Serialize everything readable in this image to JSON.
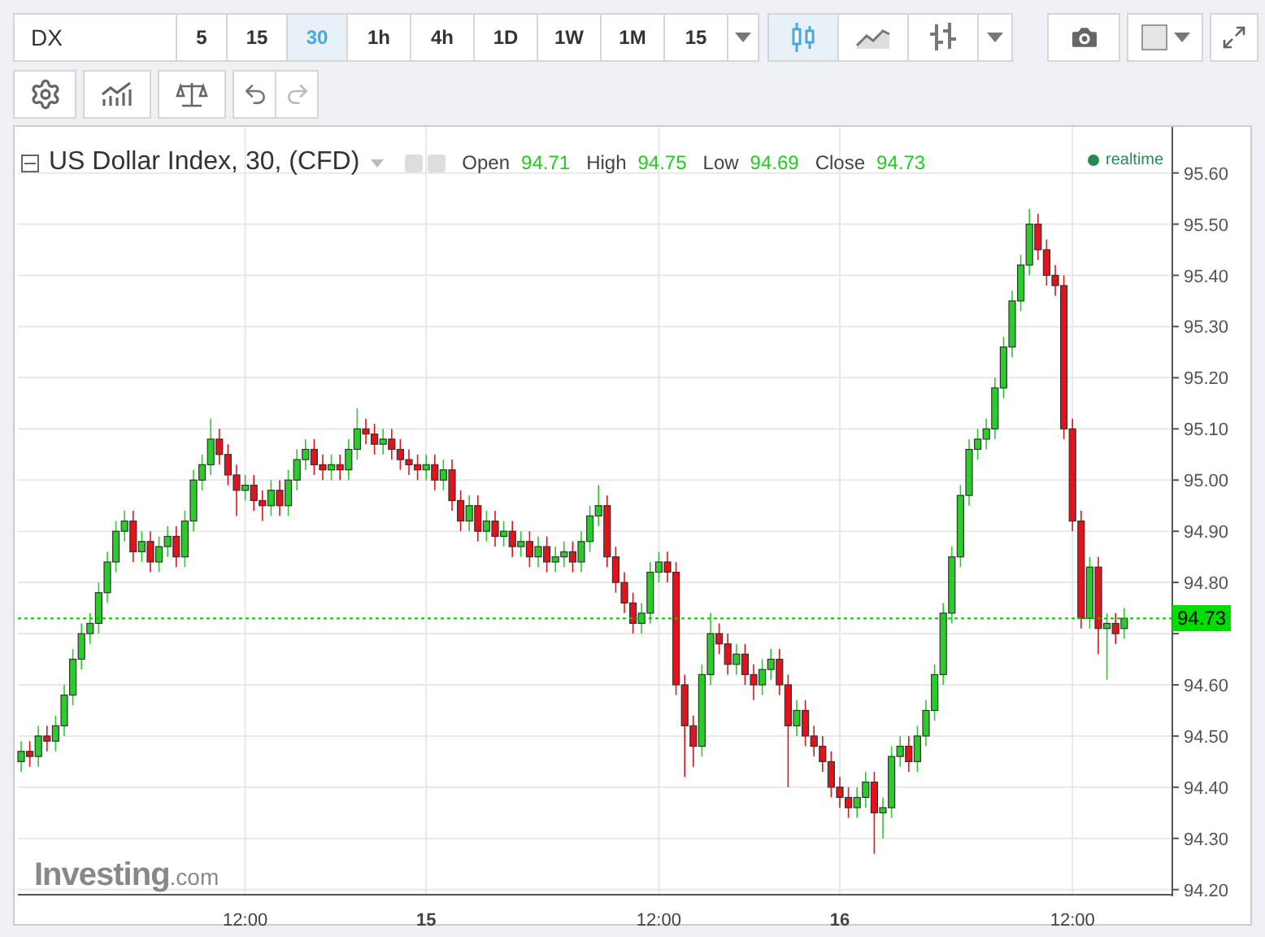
{
  "symbol": {
    "value": "DX"
  },
  "intervals": [
    {
      "label": "5",
      "selected": false
    },
    {
      "label": "15",
      "selected": false
    },
    {
      "label": "30",
      "selected": true
    },
    {
      "label": "1h",
      "selected": false
    },
    {
      "label": "4h",
      "selected": false
    },
    {
      "label": "1D",
      "selected": false
    },
    {
      "label": "1W",
      "selected": false
    },
    {
      "label": "1M",
      "selected": false
    },
    {
      "label": "15",
      "selected": false
    }
  ],
  "chart_types": [
    {
      "kind": "candles",
      "selected": true
    },
    {
      "kind": "line",
      "selected": false
    },
    {
      "kind": "bars",
      "selected": false
    }
  ],
  "legend": {
    "title": "US Dollar Index, 30, (CFD)",
    "fields": [
      {
        "label": "Open",
        "value": "94.71"
      },
      {
        "label": "High",
        "value": "94.75"
      },
      {
        "label": "Low",
        "value": "94.69"
      },
      {
        "label": "Close",
        "value": "94.73"
      }
    ],
    "status": "realtime"
  },
  "chart_data": {
    "type": "candlestick",
    "categories": [
      null,
      null,
      null,
      null,
      null,
      null,
      null,
      null,
      null,
      null,
      null,
      null,
      null,
      null,
      null,
      null,
      null,
      null,
      null,
      null,
      null,
      null,
      null,
      null,
      null,
      null,
      "12:00",
      null,
      null,
      null,
      null,
      null,
      null,
      null,
      null,
      null,
      null,
      null,
      null,
      null,
      null,
      null,
      null,
      null,
      null,
      null,
      null,
      "15",
      null,
      null,
      null,
      null,
      null,
      null,
      null,
      null,
      null,
      null,
      null,
      null,
      null,
      null,
      null,
      null,
      null,
      null,
      null,
      null,
      null,
      null,
      null,
      null,
      null,
      null,
      "12:00",
      null,
      null,
      null,
      null,
      null,
      null,
      null,
      null,
      null,
      null,
      null,
      null,
      null,
      null,
      null,
      null,
      null,
      null,
      null,
      null,
      "16",
      null,
      null,
      null,
      null,
      null,
      null,
      null,
      null,
      null,
      null,
      null,
      null,
      null,
      null,
      null,
      null,
      null,
      null,
      null,
      null,
      null,
      null,
      null,
      null,
      null,
      null,
      "12:00",
      null,
      null,
      null,
      null,
      null,
      null
    ],
    "ohlc": [
      [
        94.45,
        94.49,
        94.43,
        94.47
      ],
      [
        94.47,
        94.49,
        94.44,
        94.46
      ],
      [
        94.46,
        94.52,
        94.44,
        94.5
      ],
      [
        94.5,
        94.52,
        94.47,
        94.49
      ],
      [
        94.49,
        94.54,
        94.47,
        94.52
      ],
      [
        94.52,
        94.6,
        94.5,
        94.58
      ],
      [
        94.58,
        94.67,
        94.56,
        94.65
      ],
      [
        94.65,
        94.72,
        94.63,
        94.7
      ],
      [
        94.7,
        94.74,
        94.68,
        94.72
      ],
      [
        94.72,
        94.8,
        94.7,
        94.78
      ],
      [
        94.78,
        94.86,
        94.76,
        94.84
      ],
      [
        94.84,
        94.92,
        94.82,
        94.9
      ],
      [
        94.9,
        94.94,
        94.88,
        94.92
      ],
      [
        94.92,
        94.94,
        94.84,
        94.86
      ],
      [
        94.86,
        94.9,
        94.84,
        94.88
      ],
      [
        94.88,
        94.9,
        94.82,
        94.84
      ],
      [
        94.84,
        94.89,
        94.82,
        94.87
      ],
      [
        94.87,
        94.91,
        94.85,
        94.89
      ],
      [
        94.89,
        94.91,
        94.83,
        94.85
      ],
      [
        94.85,
        94.94,
        94.83,
        94.92
      ],
      [
        94.92,
        95.02,
        94.9,
        95.0
      ],
      [
        95.0,
        95.05,
        94.98,
        95.03
      ],
      [
        95.03,
        95.12,
        95.01,
        95.08
      ],
      [
        95.08,
        95.1,
        95.03,
        95.05
      ],
      [
        95.05,
        95.07,
        94.99,
        95.01
      ],
      [
        95.01,
        95.03,
        94.93,
        94.98
      ],
      [
        94.98,
        95.01,
        94.96,
        94.99
      ],
      [
        94.99,
        95.01,
        94.94,
        94.96
      ],
      [
        94.96,
        94.98,
        94.92,
        94.95
      ],
      [
        94.95,
        95.0,
        94.93,
        94.98
      ],
      [
        94.98,
        95.0,
        94.93,
        94.95
      ],
      [
        94.95,
        95.02,
        94.93,
        95.0
      ],
      [
        95.0,
        95.06,
        94.98,
        95.04
      ],
      [
        95.04,
        95.08,
        95.02,
        95.06
      ],
      [
        95.06,
        95.08,
        95.01,
        95.03
      ],
      [
        95.03,
        95.05,
        95.0,
        95.02
      ],
      [
        95.02,
        95.05,
        95.0,
        95.03
      ],
      [
        95.03,
        95.05,
        95.0,
        95.02
      ],
      [
        95.02,
        95.08,
        95.0,
        95.06
      ],
      [
        95.06,
        95.14,
        95.04,
        95.1
      ],
      [
        95.1,
        95.12,
        95.07,
        95.09
      ],
      [
        95.09,
        95.11,
        95.05,
        95.07
      ],
      [
        95.07,
        95.1,
        95.05,
        95.08
      ],
      [
        95.08,
        95.1,
        95.04,
        95.06
      ],
      [
        95.06,
        95.08,
        95.02,
        95.04
      ],
      [
        95.04,
        95.06,
        95.01,
        95.03
      ],
      [
        95.03,
        95.05,
        95.0,
        95.02
      ],
      [
        95.02,
        95.05,
        95.0,
        95.03
      ],
      [
        95.03,
        95.05,
        94.98,
        95.0
      ],
      [
        95.0,
        95.04,
        94.98,
        95.02
      ],
      [
        95.02,
        95.04,
        94.94,
        94.96
      ],
      [
        94.96,
        94.98,
        94.9,
        94.92
      ],
      [
        94.92,
        94.97,
        94.9,
        94.95
      ],
      [
        94.95,
        94.97,
        94.88,
        94.9
      ],
      [
        94.9,
        94.94,
        94.88,
        94.92
      ],
      [
        94.92,
        94.94,
        94.87,
        94.89
      ],
      [
        94.89,
        94.92,
        94.87,
        94.9
      ],
      [
        94.9,
        94.92,
        94.85,
        94.87
      ],
      [
        94.87,
        94.9,
        94.85,
        94.88
      ],
      [
        94.88,
        94.9,
        94.83,
        94.85
      ],
      [
        94.85,
        94.89,
        94.83,
        94.87
      ],
      [
        94.87,
        94.89,
        94.82,
        94.84
      ],
      [
        94.84,
        94.87,
        94.82,
        94.85
      ],
      [
        94.85,
        94.88,
        94.83,
        94.86
      ],
      [
        94.86,
        94.88,
        94.82,
        94.84
      ],
      [
        94.84,
        94.9,
        94.82,
        94.88
      ],
      [
        94.88,
        94.95,
        94.86,
        94.93
      ],
      [
        94.93,
        94.99,
        94.91,
        94.95
      ],
      [
        94.95,
        94.97,
        94.83,
        94.85
      ],
      [
        94.85,
        94.87,
        94.78,
        94.8
      ],
      [
        94.8,
        94.82,
        94.74,
        94.76
      ],
      [
        94.76,
        94.78,
        94.7,
        94.72
      ],
      [
        94.72,
        94.76,
        94.7,
        94.74
      ],
      [
        94.74,
        94.84,
        94.72,
        94.82
      ],
      [
        94.82,
        94.86,
        94.8,
        94.84
      ],
      [
        94.84,
        94.86,
        94.8,
        94.82
      ],
      [
        94.82,
        94.84,
        94.58,
        94.6
      ],
      [
        94.6,
        94.62,
        94.42,
        94.52
      ],
      [
        94.52,
        94.54,
        94.44,
        94.48
      ],
      [
        94.48,
        94.64,
        94.46,
        94.62
      ],
      [
        94.62,
        94.74,
        94.6,
        94.7
      ],
      [
        94.7,
        94.72,
        94.66,
        94.68
      ],
      [
        94.68,
        94.7,
        94.62,
        94.64
      ],
      [
        94.64,
        94.68,
        94.62,
        94.66
      ],
      [
        94.66,
        94.68,
        94.6,
        94.62
      ],
      [
        94.62,
        94.64,
        94.57,
        94.6
      ],
      [
        94.6,
        94.65,
        94.58,
        94.63
      ],
      [
        94.63,
        94.67,
        94.61,
        94.65
      ],
      [
        94.65,
        94.67,
        94.58,
        94.6
      ],
      [
        94.6,
        94.62,
        94.4,
        94.52
      ],
      [
        94.52,
        94.57,
        94.5,
        94.55
      ],
      [
        94.55,
        94.57,
        94.48,
        94.5
      ],
      [
        94.5,
        94.52,
        94.46,
        94.48
      ],
      [
        94.48,
        94.5,
        94.43,
        94.45
      ],
      [
        94.45,
        94.47,
        94.38,
        94.4
      ],
      [
        94.4,
        94.42,
        94.36,
        94.38
      ],
      [
        94.38,
        94.4,
        94.34,
        94.36
      ],
      [
        94.36,
        94.4,
        94.34,
        94.38
      ],
      [
        94.38,
        94.43,
        94.36,
        94.41
      ],
      [
        94.41,
        94.43,
        94.27,
        94.35
      ],
      [
        94.35,
        94.38,
        94.3,
        94.36
      ],
      [
        94.36,
        94.48,
        94.34,
        94.46
      ],
      [
        94.46,
        94.5,
        94.44,
        94.48
      ],
      [
        94.48,
        94.5,
        94.43,
        94.45
      ],
      [
        94.45,
        94.52,
        94.43,
        94.5
      ],
      [
        94.5,
        94.57,
        94.48,
        94.55
      ],
      [
        94.55,
        94.64,
        94.53,
        94.62
      ],
      [
        94.62,
        94.76,
        94.6,
        94.74
      ],
      [
        94.74,
        94.87,
        94.72,
        94.85
      ],
      [
        94.85,
        94.99,
        94.83,
        94.97
      ],
      [
        94.97,
        95.08,
        94.95,
        95.06
      ],
      [
        95.06,
        95.1,
        95.04,
        95.08
      ],
      [
        95.08,
        95.12,
        95.06,
        95.1
      ],
      [
        95.1,
        95.2,
        95.08,
        95.18
      ],
      [
        95.18,
        95.28,
        95.16,
        95.26
      ],
      [
        95.26,
        95.37,
        95.24,
        95.35
      ],
      [
        95.35,
        95.44,
        95.33,
        95.42
      ],
      [
        95.42,
        95.53,
        95.4,
        95.5
      ],
      [
        95.5,
        95.52,
        95.43,
        95.45
      ],
      [
        95.45,
        95.47,
        95.38,
        95.4
      ],
      [
        95.4,
        95.42,
        95.36,
        95.38
      ],
      [
        95.38,
        95.4,
        95.08,
        95.1
      ],
      [
        95.1,
        95.12,
        94.9,
        94.92
      ],
      [
        94.92,
        94.94,
        94.71,
        94.73
      ],
      [
        94.73,
        94.85,
        94.71,
        94.83
      ],
      [
        94.83,
        94.85,
        94.66,
        94.71
      ],
      [
        94.71,
        94.74,
        94.61,
        94.72
      ],
      [
        94.72,
        94.74,
        94.68,
        94.7
      ],
      [
        94.71,
        94.75,
        94.69,
        94.73
      ]
    ],
    "ylim": [
      94.19,
      95.69
    ],
    "grid": true,
    "ref_lines": [
      {
        "axis": "y",
        "value": 94.73,
        "label": "94.73"
      }
    ],
    "yticks": [
      {
        "value": 95.6,
        "label": "95.60"
      },
      {
        "value": 95.5,
        "label": "95.50"
      },
      {
        "value": 95.4,
        "label": "95.40"
      },
      {
        "value": 95.3,
        "label": "95.30"
      },
      {
        "value": 95.2,
        "label": "95.20"
      },
      {
        "value": 95.1,
        "label": "95.10"
      },
      {
        "value": 95.0,
        "label": "95.00"
      },
      {
        "value": 94.9,
        "label": "94.90"
      },
      {
        "value": 94.8,
        "label": "94.80"
      },
      {
        "value": 94.6,
        "label": "94.60"
      },
      {
        "value": 94.5,
        "label": "94.50"
      },
      {
        "value": 94.4,
        "label": "94.40"
      },
      {
        "value": 94.3,
        "label": "94.30"
      },
      {
        "value": 94.2,
        "label": "94.20"
      }
    ]
  },
  "time_axis": [
    {
      "kind": "time"
    },
    {
      "kind": "day"
    },
    {
      "kind": "time"
    },
    {
      "kind": "day"
    },
    {
      "kind": "time"
    }
  ],
  "logo": {
    "name": "Investing",
    "suffix": ".com"
  }
}
